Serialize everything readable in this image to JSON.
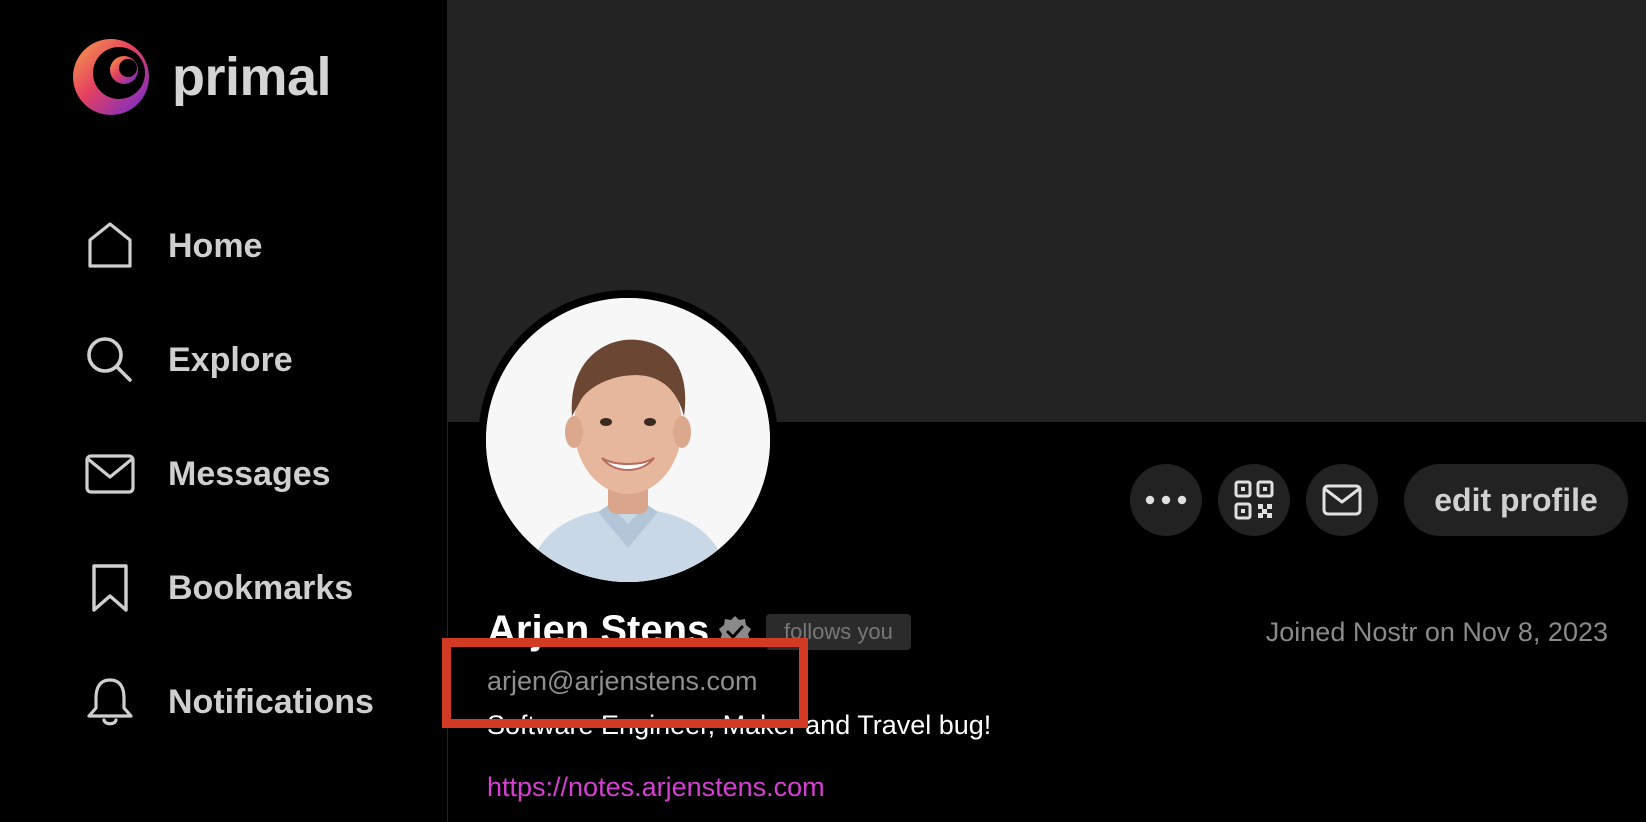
{
  "app": {
    "name": "primal"
  },
  "nav": [
    {
      "label": "Home",
      "icon": "home-icon"
    },
    {
      "label": "Explore",
      "icon": "search-icon"
    },
    {
      "label": "Messages",
      "icon": "mail-icon"
    },
    {
      "label": "Bookmarks",
      "icon": "bookmark-icon"
    },
    {
      "label": "Notifications",
      "icon": "bell-icon"
    }
  ],
  "profile": {
    "name": "Arjen Stens",
    "follows_badge": "follows you",
    "joined": "Joined Nostr on Nov 8, 2023",
    "nip05": "arjen@arjenstens.com",
    "bio": "Software Engineer, Maker and Travel bug!",
    "website": "https://notes.arjenstens.com"
  },
  "actions": {
    "more_icon": "more-icon",
    "qr_icon": "qr-code-icon",
    "message_icon": "mail-icon",
    "edit_label": "edit profile"
  },
  "colors": {
    "accent_link": "#d63fd1",
    "highlight_box": "#d23a24",
    "background": "#000000",
    "banner": "#232323"
  }
}
